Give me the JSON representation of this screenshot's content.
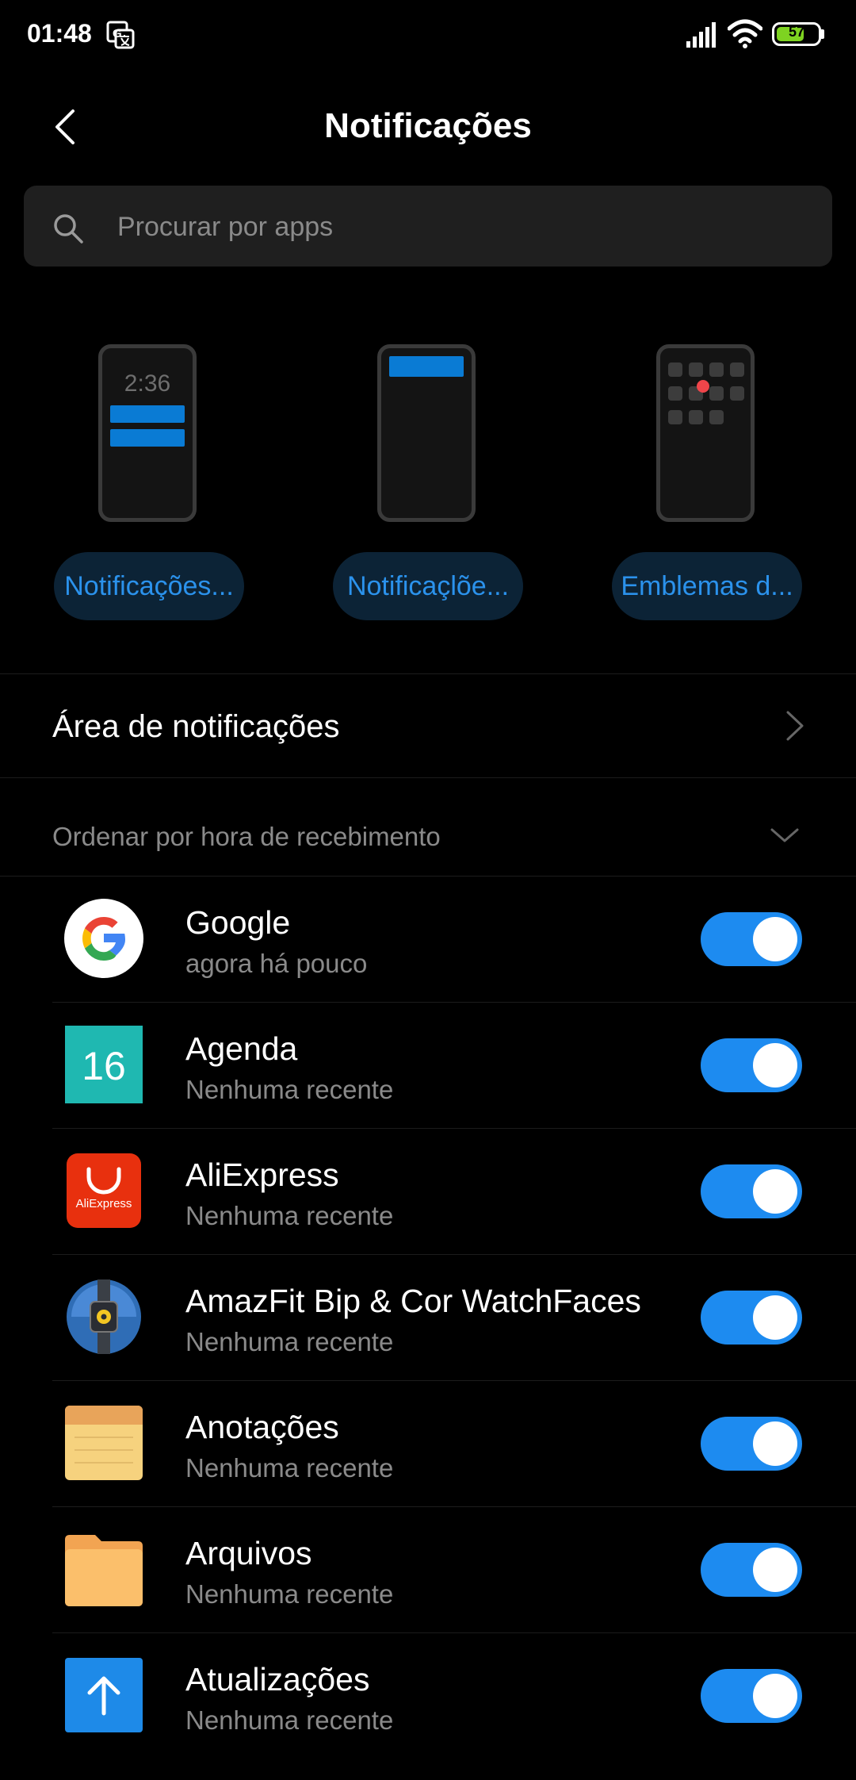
{
  "status_bar": {
    "time": "01:48",
    "battery_level": "57",
    "icons": [
      "translate-icon",
      "signal-icon",
      "wifi-icon",
      "battery-icon"
    ]
  },
  "header": {
    "title": "Notificações",
    "back_icon": "chevron-left-icon"
  },
  "search": {
    "placeholder": "Procurar por apps",
    "icon": "search-icon"
  },
  "styles": [
    {
      "label": "Notificações...",
      "preview_time": "2:36"
    },
    {
      "label": "Notificaçlõe..."
    },
    {
      "label": "Emblemas d..."
    }
  ],
  "area_row": {
    "label": "Área de notificações"
  },
  "sort": {
    "label": "Ordenar por hora de recebimento"
  },
  "apps": [
    {
      "name": "Google",
      "subtitle": "agora há pouco",
      "icon": "google-icon",
      "enabled": true
    },
    {
      "name": "Agenda",
      "subtitle": "Nenhuma recente",
      "icon": "calendar-icon",
      "icon_text": "16",
      "enabled": true
    },
    {
      "name": "AliExpress",
      "subtitle": "Nenhuma recente",
      "icon": "aliexpress-icon",
      "icon_text": "AliExpress",
      "enabled": true
    },
    {
      "name": "AmazFit Bip & Cor WatchFaces",
      "subtitle": "Nenhuma recente",
      "icon": "watch-icon",
      "enabled": true
    },
    {
      "name": "Anotações",
      "subtitle": "Nenhuma recente",
      "icon": "notes-icon",
      "enabled": true
    },
    {
      "name": "Arquivos",
      "subtitle": "Nenhuma recente",
      "icon": "folder-icon",
      "enabled": true
    },
    {
      "name": "Atualizações",
      "subtitle": "Nenhuma recente",
      "icon": "update-arrow-icon",
      "enabled": true
    }
  ],
  "colors": {
    "accent": "#1d8bf0",
    "pill_bg": "#0c2336",
    "pill_text": "#2b92ec",
    "background": "#000000"
  }
}
